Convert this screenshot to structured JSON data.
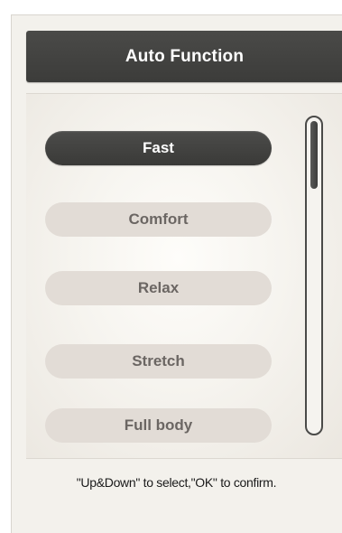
{
  "header": {
    "title": "Auto Function"
  },
  "menu": {
    "items": [
      {
        "label": "Fast",
        "selected": true
      },
      {
        "label": "Comfort",
        "selected": false
      },
      {
        "label": "Relax",
        "selected": false
      },
      {
        "label": "Stretch",
        "selected": false
      },
      {
        "label": "Full body",
        "selected": false
      }
    ]
  },
  "scrollbar": {
    "position": 0,
    "visible_fraction": 0.22
  },
  "footer": {
    "hint": "\"Up&Down\" to select,\"OK\" to confirm."
  },
  "colors": {
    "header_bg": "#3f3f3d",
    "selected_item_bg": "#414140",
    "item_bg": "#e2dcd6",
    "item_text": "#6b6663",
    "panel_bg": "#f3f1ec"
  }
}
